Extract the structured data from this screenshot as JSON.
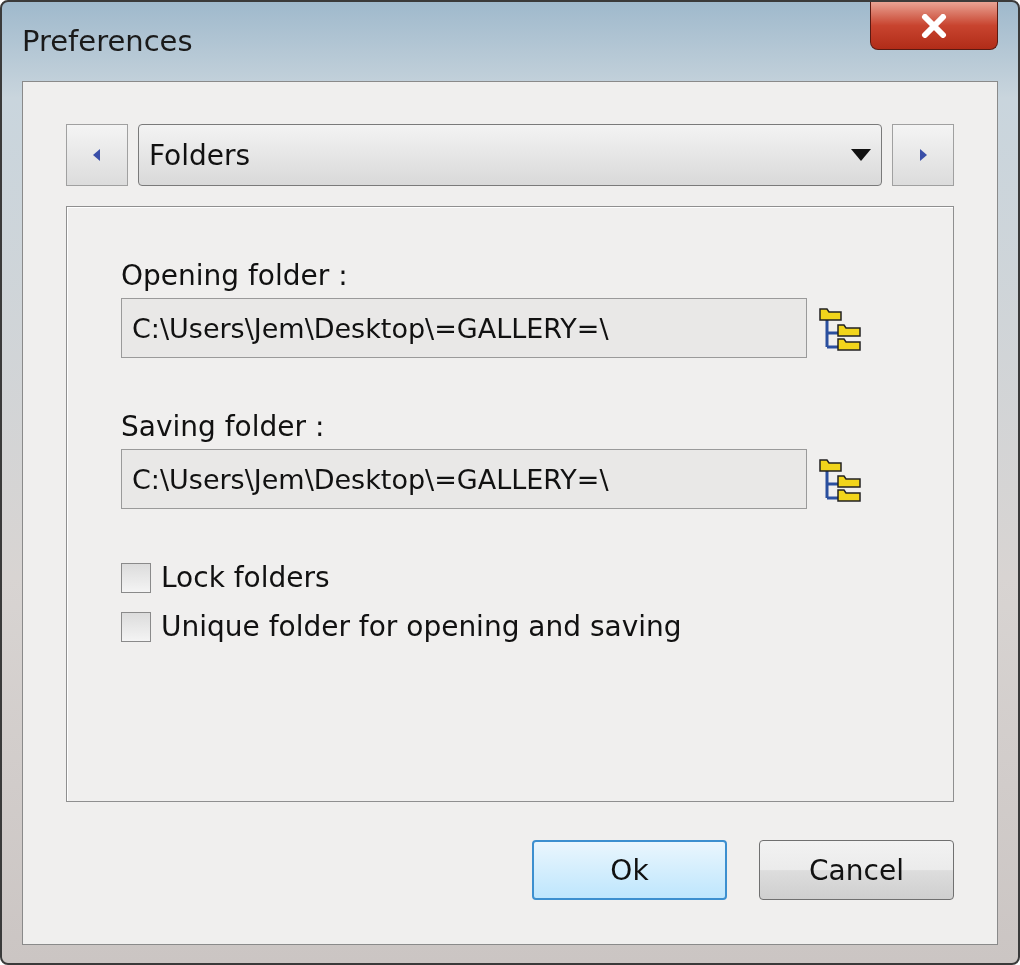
{
  "window": {
    "title": "Preferences"
  },
  "page_selector": {
    "value": "Folders"
  },
  "fields": [
    {
      "label": "Opening folder :",
      "value": "C:\\Users\\Jem\\Desktop\\=GALLERY=\\"
    },
    {
      "label": "Saving folder :",
      "value": "C:\\Users\\Jem\\Desktop\\=GALLERY=\\"
    }
  ],
  "options": [
    {
      "label": "Lock folders",
      "checked": false
    },
    {
      "label": "Unique folder for opening and saving",
      "checked": false
    }
  ],
  "buttons": [
    {
      "label": "Ok",
      "kind": "default"
    },
    {
      "label": "Cancel",
      "kind": "normal"
    }
  ]
}
